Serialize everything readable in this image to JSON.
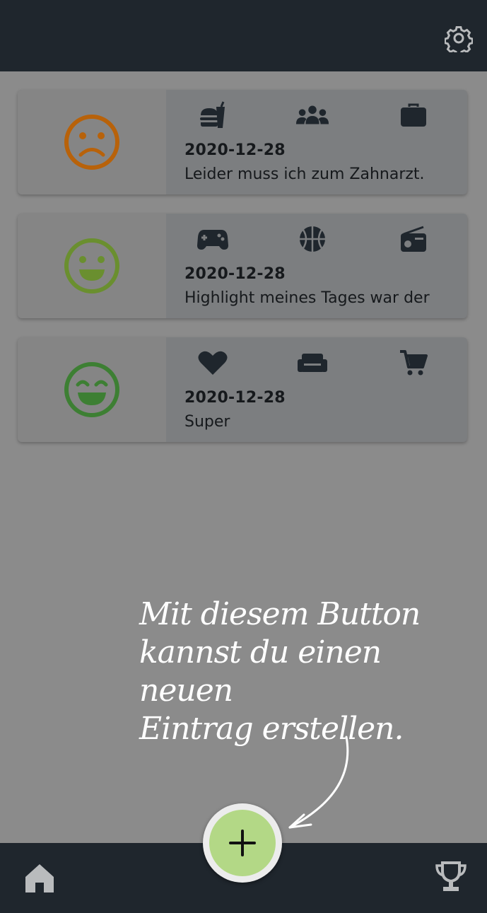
{
  "entries": [
    {
      "mood": "sad",
      "mood_color": "#b8620a",
      "date": "2020-12-28",
      "text": "Leider muss ich zum Zahnarzt.",
      "activity_icons": [
        "fast-food-icon",
        "people-icon",
        "briefcase-icon"
      ]
    },
    {
      "mood": "happy",
      "mood_color": "#6a8f2f",
      "date": "2020-12-28",
      "text": "Highlight meines Tages war der",
      "activity_icons": [
        "gamepad-icon",
        "basketball-icon",
        "radio-icon"
      ]
    },
    {
      "mood": "very-happy",
      "mood_color": "#3d7f33",
      "date": "2020-12-28",
      "text": "Super",
      "activity_icons": [
        "heart-icon",
        "couch-icon",
        "shopping-cart-icon"
      ]
    }
  ],
  "tutorial": {
    "hint_line1": "Mit diesem Button",
    "hint_line2": "kannst du einen neuen",
    "hint_line3": "Eintrag erstellen."
  },
  "colors": {
    "topbar": "#1f262d",
    "overlay": "#8b8b8b",
    "fab": "#b3d886",
    "icon": "#1f262d"
  },
  "nav": {
    "left_icon": "home-icon",
    "fab_icon": "plus-icon",
    "right_icon": "trophy-icon",
    "top_right_icon": "gear-icon"
  }
}
